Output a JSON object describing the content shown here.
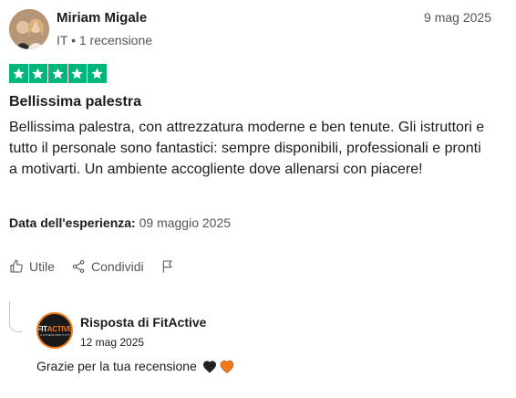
{
  "reviewer": {
    "name": "Miriam Migale",
    "meta": "IT • 1 recensione",
    "date": "9 mag 2025"
  },
  "rating": {
    "value": 5,
    "max": 5,
    "color": "#00b67a"
  },
  "review": {
    "title": "Bellissima palestra",
    "body": "Bellissima palestra, con attrezzatura moderne e ben tenute. Gli istruttori e tutto il personale sono fantastici: sempre disponibili, professionali e pronti a motivarti. Un ambiente accogliente dove allenarsi con piacere!",
    "experience_label": "Data dell'esperienza:",
    "experience_date": "09 maggio 2025"
  },
  "actions": {
    "useful_label": "Utile",
    "share_label": "Condividi"
  },
  "reply": {
    "title": "Risposta di FitActive",
    "date": "12 mag 2025",
    "text": "Grazie per la tua recensione",
    "hearts": [
      "#222222",
      "#f27a1a"
    ],
    "brand_color": "#f27a1a",
    "logo_text_1": "FIT",
    "logo_text_2": "ACTIVE",
    "logo_tagline": "IL FITNESS PER TUTTI"
  }
}
